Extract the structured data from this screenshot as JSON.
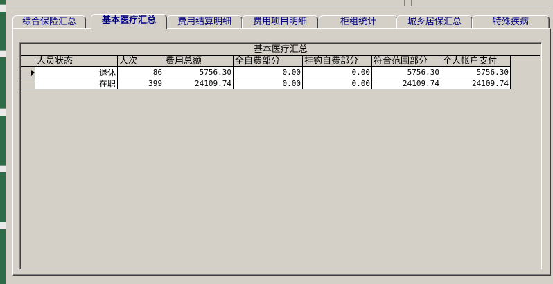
{
  "tabs": [
    {
      "label": "综合保险汇总"
    },
    {
      "label": "基本医疗汇总"
    },
    {
      "label": "费用结算明细"
    },
    {
      "label": "费用项目明细"
    },
    {
      "label": "柜组统计"
    },
    {
      "label": "城乡居保汇总"
    },
    {
      "label": "特殊疾病"
    }
  ],
  "active_tab": "基本医疗汇总",
  "grid": {
    "caption": "基本医疗汇总",
    "columns": [
      "人员状态",
      "人次",
      "费用总额",
      "全自费部分",
      "挂钩自费部分",
      "符合范围部分",
      "个人帐户支付"
    ],
    "rows": [
      [
        "退休",
        "86",
        "5756.30",
        "0.00",
        "0.00",
        "5756.30",
        "5756.30"
      ],
      [
        "在职",
        "399",
        "24109.74",
        "0.00",
        "0.00",
        "24109.74",
        "24109.74"
      ]
    ],
    "current_row": 0
  },
  "colors": {
    "window_bg": "#d4d0c8",
    "tab_text": "#000080",
    "left_strip": "#2e6b47"
  }
}
